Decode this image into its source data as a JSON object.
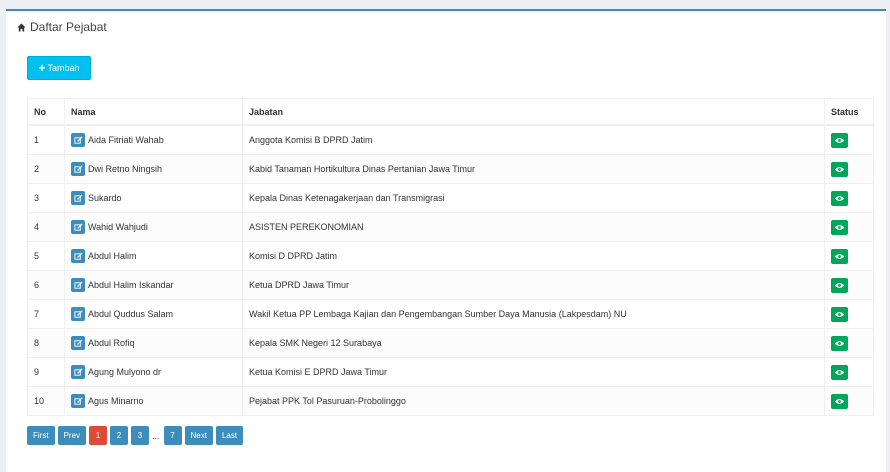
{
  "header": {
    "title": "Daftar Pejabat"
  },
  "toolbar": {
    "add_label": "Tambah"
  },
  "table": {
    "columns": {
      "no": "No",
      "nama": "Nama",
      "jabatan": "Jabatan",
      "status": "Status"
    },
    "rows": [
      {
        "no": "1",
        "nama": "Aida Fitriati Wahab",
        "jabatan": "Anggota Komisi B DPRD Jatim"
      },
      {
        "no": "2",
        "nama": "Dwi Retno Ningsih",
        "jabatan": "Kabid Tanaman Hortikultura Dinas Pertanian Jawa Timur"
      },
      {
        "no": "3",
        "nama": "Sukardo",
        "jabatan": "Kepala Dinas Ketenagakerjaan dan Transmigrasi"
      },
      {
        "no": "4",
        "nama": "Wahid Wahjudi",
        "jabatan": "ASISTEN PEREKONOMIAN"
      },
      {
        "no": "5",
        "nama": "Abdul Halim",
        "jabatan": "Komisi D DPRD Jatim"
      },
      {
        "no": "6",
        "nama": "Abdul Halim Iskandar",
        "jabatan": "Ketua DPRD Jawa Timur"
      },
      {
        "no": "7",
        "nama": "Abdul Quddus Salam",
        "jabatan": "Wakil Ketua PP Lembaga Kajian dan Pengembangan Sumber Daya Manusia (Lakpesdam) NU"
      },
      {
        "no": "8",
        "nama": "Abdul Rofiq",
        "jabatan": "Kepala SMK Negeri 12 Surabaya"
      },
      {
        "no": "9",
        "nama": "Agung Mulyono dr",
        "jabatan": "Ketua Komisi E DPRD Jawa Timur"
      },
      {
        "no": "10",
        "nama": "Agus Minarno",
        "jabatan": "Pejabat PPK Tol Pasuruan-Probolinggo"
      }
    ]
  },
  "pagination": {
    "first": "First",
    "prev": "Prev",
    "pages": [
      "1",
      "2",
      "3"
    ],
    "ellipsis": "...",
    "last_page": "7",
    "next": "Next",
    "last": "Last",
    "current": "1"
  },
  "icons": {
    "header": "home-icon",
    "add": "plus-icon",
    "edit": "edit-icon",
    "status": "eye-icon"
  },
  "colors": {
    "accent": "#3c8dbc",
    "add_button": "#00c0ef",
    "status_button": "#00a65a",
    "active_page": "#dd4b39"
  }
}
